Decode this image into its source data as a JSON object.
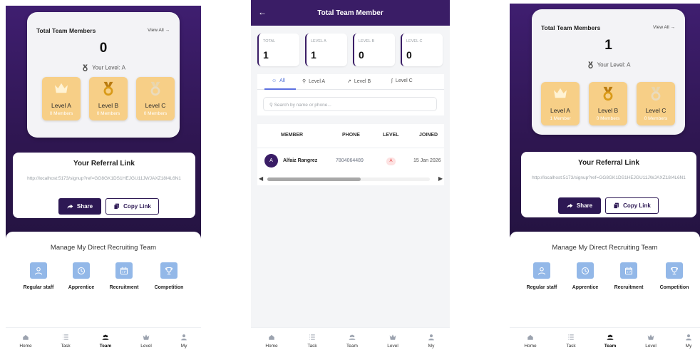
{
  "screens": [
    {
      "summary": {
        "title": "Total Team Members",
        "view_all": "View All →",
        "count": "0",
        "your_level": "Your Level: A"
      },
      "levels": [
        {
          "name": "Level A",
          "members": "0 Members",
          "icon": "crown-icon",
          "color": "#fff3d4"
        },
        {
          "name": "Level B",
          "members": "0 Members",
          "icon": "gold-medal-icon",
          "color": "#d99a18"
        },
        {
          "name": "Level C",
          "members": "0 Members",
          "icon": "silver-medal-icon",
          "color": "#e9d6ae"
        }
      ],
      "referral": {
        "title": "Your Referral Link",
        "url": "http://localhost:5173/signup?ref=GG8GK1DS1HEJGU11JWJAXZ18I4L6N1",
        "share_label": "Share",
        "copy_label": "Copy Link"
      },
      "manage": {
        "title": "Manage My Direct Recruiting Team",
        "items": [
          {
            "label": "Regular staff",
            "icon": "person-icon"
          },
          {
            "label": "Apprentice",
            "icon": "clock-icon"
          },
          {
            "label": "Recruitment",
            "icon": "calendar-icon"
          },
          {
            "label": "Competition",
            "icon": "trophy-icon"
          }
        ]
      },
      "nav": [
        {
          "label": "Home",
          "icon": "home-icon"
        },
        {
          "label": "Task",
          "icon": "task-list-icon"
        },
        {
          "label": "Team",
          "icon": "team-icon",
          "active": true
        },
        {
          "label": "Level",
          "icon": "level-crown-icon"
        },
        {
          "label": "My",
          "icon": "profile-icon"
        }
      ]
    },
    {
      "header": {
        "title": "Total Team Member",
        "back_icon": "arrow-left-icon"
      },
      "stats": [
        {
          "key": "TOTAL",
          "value": "1"
        },
        {
          "key": "LEVEL A",
          "value": "1"
        },
        {
          "key": "LEVEL B",
          "value": "0"
        },
        {
          "key": "LEVEL C",
          "value": "0"
        }
      ],
      "tabs": [
        {
          "label": "All",
          "icon": "users-icon",
          "active": true
        },
        {
          "label": "Level A",
          "icon": "trophy-icon"
        },
        {
          "label": "Level B",
          "icon": "trending-icon"
        },
        {
          "label": "Level C",
          "icon": "signature-icon"
        }
      ],
      "search": {
        "placeholder": "Search by name or phone..."
      },
      "table": {
        "headers": [
          "MEMBER",
          "PHONE",
          "LEVEL",
          "JOINED"
        ],
        "rows": [
          {
            "avatar": "A",
            "member": "Alfaiz Rangrez",
            "phone": "7804064489",
            "level": "A",
            "joined": "15 Jan 2026"
          }
        ]
      },
      "nav": [
        {
          "label": "Home"
        },
        {
          "label": "Task"
        },
        {
          "label": "Team"
        },
        {
          "label": "Level"
        },
        {
          "label": "My"
        }
      ]
    },
    {
      "summary": {
        "title": "Total Team Members",
        "view_all": "View All →",
        "count": "1",
        "your_level": "Your Level: A"
      },
      "levels": [
        {
          "name": "Level A",
          "members": "1 Member",
          "icon": "crown-icon"
        },
        {
          "name": "Level B",
          "members": "0 Members",
          "icon": "gold-medal-icon"
        },
        {
          "name": "Level C",
          "members": "0 Members",
          "icon": "silver-medal-icon"
        }
      ],
      "referral": {
        "title": "Your Referral Link",
        "url": "http://localhost:5173/signup?ref=GG8GK1DS1HEJGU11JWJAXZ18I4L6N1",
        "share_label": "Share",
        "copy_label": "Copy Link"
      },
      "manage": {
        "title": "Manage My Direct Recruiting Team",
        "items": [
          {
            "label": "Regular staff"
          },
          {
            "label": "Apprentice"
          },
          {
            "label": "Recruitment"
          },
          {
            "label": "Competition"
          }
        ]
      },
      "nav": [
        {
          "label": "Home"
        },
        {
          "label": "Task"
        },
        {
          "label": "Team",
          "active": true
        },
        {
          "label": "Level"
        },
        {
          "label": "My"
        }
      ]
    }
  ],
  "colors": {
    "brand": "#3a1d66",
    "level_card": "#f7cf87",
    "manage_icon": "#93b8e8",
    "tab_active": "#4f6fd6"
  }
}
